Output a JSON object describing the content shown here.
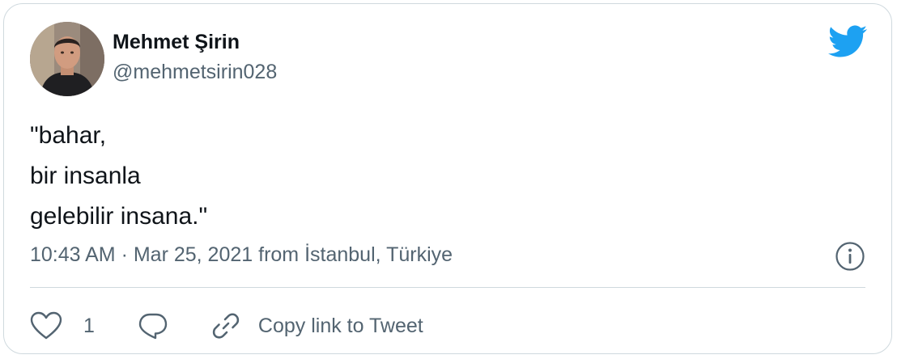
{
  "tweet": {
    "author": {
      "name": "Mehmet Şirin",
      "handle": "@mehmetsirin028"
    },
    "text": "\"bahar,\nbir insanla\ngelebilir insana.\"",
    "meta": {
      "time": "10:43 AM",
      "separator": " · ",
      "date": "Mar 25, 2021",
      "source": " from İstanbul, Türkiye"
    },
    "actions": {
      "like_count": "1",
      "copy_link_label": "Copy link to Tweet"
    }
  },
  "colors": {
    "text_primary": "#0f1419",
    "text_secondary": "#536471",
    "border": "#cfd9de",
    "brand": "#1d9bf0",
    "twitter_logo": "#1da1f2"
  },
  "icons": {
    "logo": "twitter-bird-icon",
    "info": "info-icon",
    "like": "heart-icon",
    "reply": "reply-bubble-icon",
    "copy": "link-icon"
  }
}
